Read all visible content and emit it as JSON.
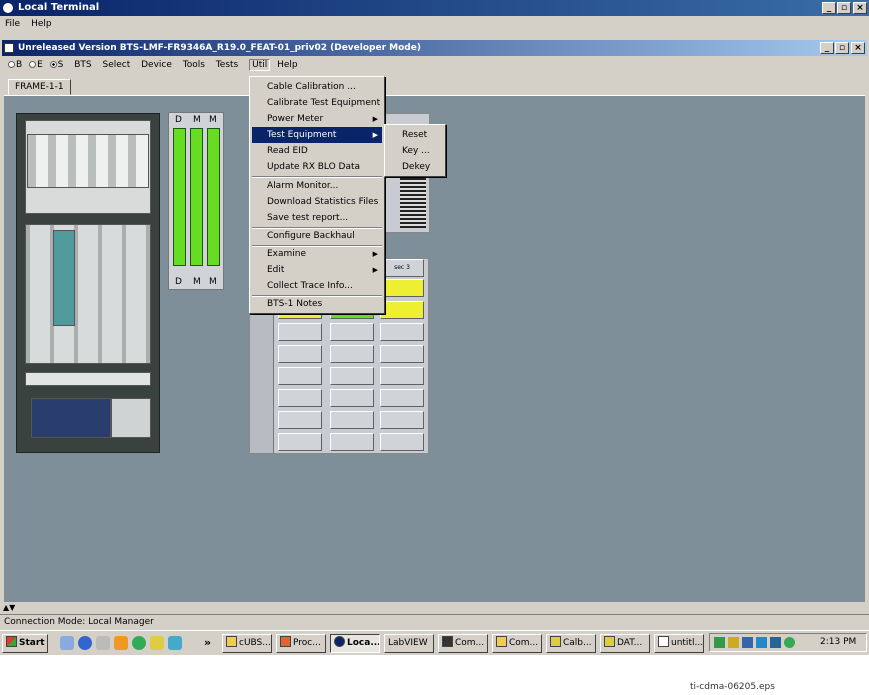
{
  "outer_window": {
    "title": "Local Terminal",
    "menu": [
      "File",
      "Help"
    ],
    "controls": [
      "_",
      "▫",
      "×"
    ]
  },
  "inner_window": {
    "title": "Unreleased Version BTS-LMF-FR9346A_R19.0_FEAT-01_priv02 (Developer Mode)",
    "controls": [
      "_",
      "▫",
      "×"
    ],
    "radios": [
      {
        "label": "B",
        "selected": false
      },
      {
        "label": "E",
        "selected": false
      },
      {
        "label": "S",
        "selected": true
      }
    ],
    "menu": [
      "BTS",
      "Select",
      "Device",
      "Tools",
      "Tests",
      "Util",
      "Help"
    ]
  },
  "tab": "FRAME-1-1",
  "modules": {
    "header": [
      "D",
      "M",
      "M"
    ],
    "footer": [
      "D",
      "M",
      "M"
    ]
  },
  "sector_header": "sec 3",
  "util_menu": {
    "items": [
      {
        "label": "Cable Calibration ...",
        "submenu": false
      },
      {
        "label": "Calibrate Test Equipment",
        "submenu": false
      },
      {
        "label": "Power Meter",
        "submenu": true
      },
      {
        "label": "Test Equipment",
        "submenu": true,
        "selected": true
      },
      {
        "label": "Read EID",
        "submenu": false
      },
      {
        "label": "Update RX BLO Data",
        "submenu": false
      },
      {
        "label": "Alarm Monitor...",
        "submenu": false
      },
      {
        "label": "Download Statistics Files",
        "submenu": false
      },
      {
        "label": "Save test report...",
        "submenu": false
      },
      {
        "label": "Configure Backhaul",
        "submenu": false
      },
      {
        "label": "Examine",
        "submenu": true
      },
      {
        "label": "Edit",
        "submenu": true
      },
      {
        "label": "Collect Trace Info...",
        "submenu": false
      },
      {
        "label": "BTS-1 Notes",
        "submenu": false
      }
    ]
  },
  "test_equipment_submenu": [
    "Reset",
    "Key ...",
    "Dekey"
  ],
  "status_bar": "Connection Mode: Local Manager",
  "taskbar": {
    "start": "Start",
    "chevron": "»",
    "tasks": [
      {
        "label": "cUBS...",
        "active": false
      },
      {
        "label": "Proc...",
        "active": false
      },
      {
        "label": "Loca...",
        "active": true
      },
      {
        "label": "LabVIEW",
        "active": false
      },
      {
        "label": "Com...",
        "active": false
      },
      {
        "label": "Com...",
        "active": false
      },
      {
        "label": "Calb...",
        "active": false
      },
      {
        "label": "DAT...",
        "active": false
      },
      {
        "label": "untitl...",
        "active": false
      }
    ],
    "clock": "2:13 PM"
  },
  "caption": "ti-cdma-06205.eps",
  "colors": {
    "title_blue": "#0a246a",
    "module_green": "#66dd22",
    "cell_yellow": "#eeee33",
    "workspace": "#7f8f9a"
  }
}
